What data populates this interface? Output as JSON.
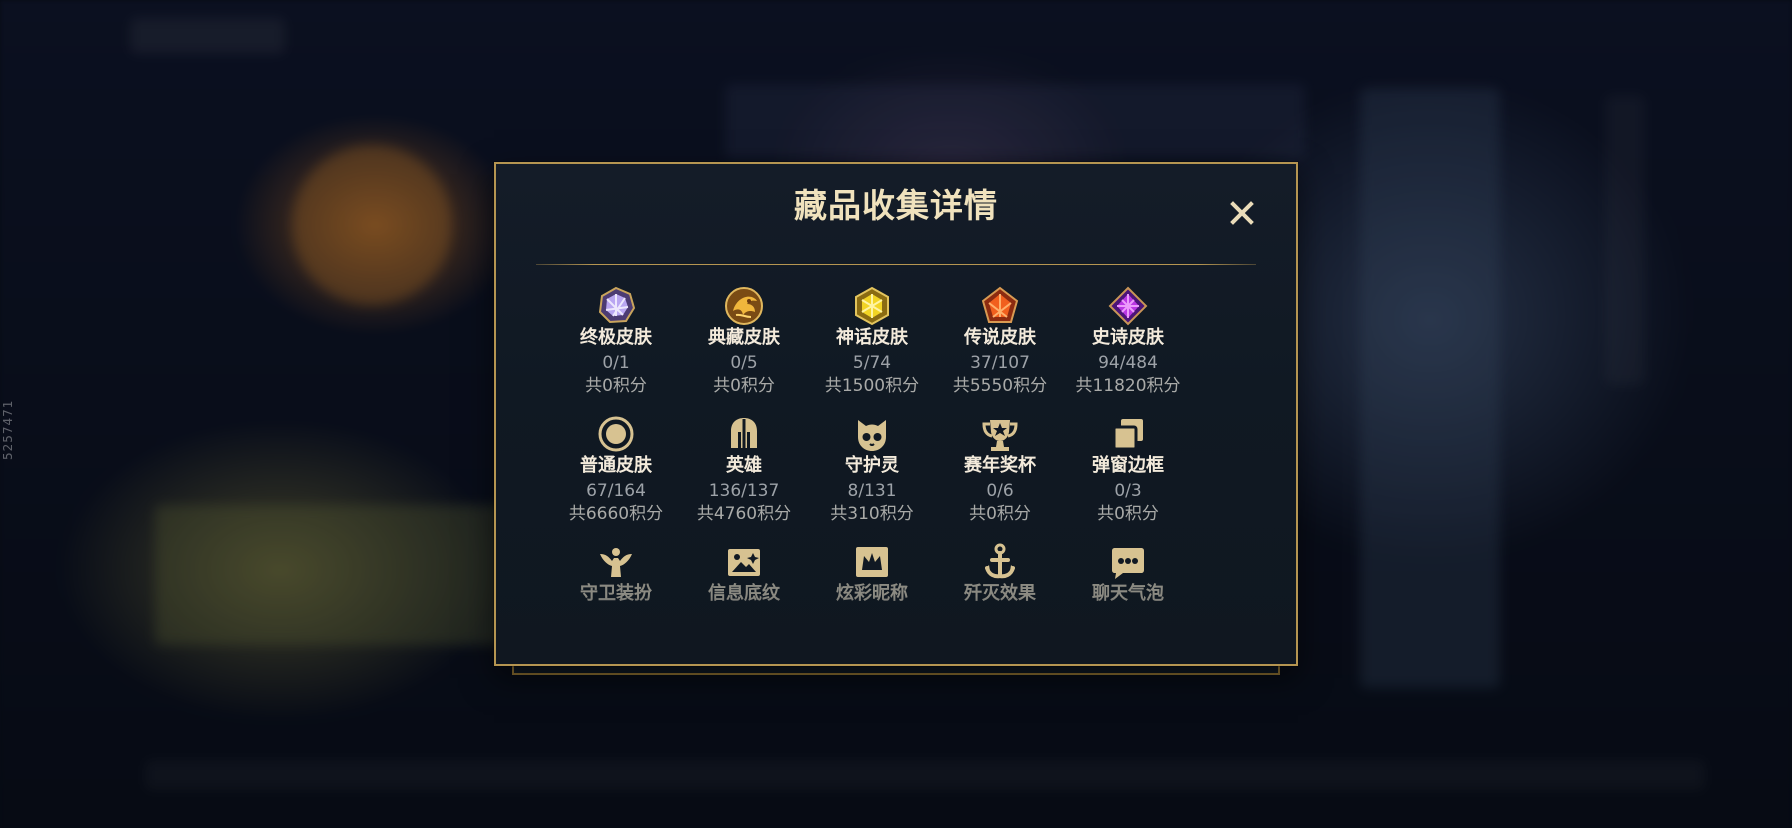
{
  "page": {
    "side_code": "5257471"
  },
  "modal": {
    "title": "藏品收集详情",
    "close_icon": "close-icon",
    "colors": {
      "gold": "#b59551",
      "title": "#f0e2bd",
      "panel": "#101923",
      "icon_gold": "#d9c28b"
    },
    "items": [
      {
        "icon": "ultimate-skin-icon",
        "title": "终极皮肤",
        "count": "0/1",
        "points": "共0积分"
      },
      {
        "icon": "collection-skin-icon",
        "title": "典藏皮肤",
        "count": "0/5",
        "points": "共0积分"
      },
      {
        "icon": "mythic-skin-icon",
        "title": "神话皮肤",
        "count": "5/74",
        "points": "共1500积分"
      },
      {
        "icon": "legendary-skin-icon",
        "title": "传说皮肤",
        "count": "37/107",
        "points": "共5550积分"
      },
      {
        "icon": "epic-skin-icon",
        "title": "史诗皮肤",
        "count": "94/484",
        "points": "共11820积分"
      },
      {
        "icon": "normal-skin-icon",
        "title": "普通皮肤",
        "count": "67/164",
        "points": "共6660积分"
      },
      {
        "icon": "hero-helmet-icon",
        "title": "英雄",
        "count": "136/137",
        "points": "共4760积分"
      },
      {
        "icon": "guardian-spirit-icon",
        "title": "守护灵",
        "count": "8/131",
        "points": "共310积分"
      },
      {
        "icon": "trophy-icon",
        "title": "赛年奖杯",
        "count": "0/6",
        "points": "共0积分"
      },
      {
        "icon": "popup-frame-icon",
        "title": "弹窗边框",
        "count": "0/3",
        "points": "共0积分"
      },
      {
        "icon": "guardian-outfit-icon",
        "title": "守卫装扮"
      },
      {
        "icon": "info-background-icon",
        "title": "信息底纹"
      },
      {
        "icon": "colorful-nickname-icon",
        "title": "炫彩昵称"
      },
      {
        "icon": "annihilation-effect-icon",
        "title": "歼灭效果"
      },
      {
        "icon": "chat-bubble-icon",
        "title": "聊天气泡"
      }
    ]
  }
}
